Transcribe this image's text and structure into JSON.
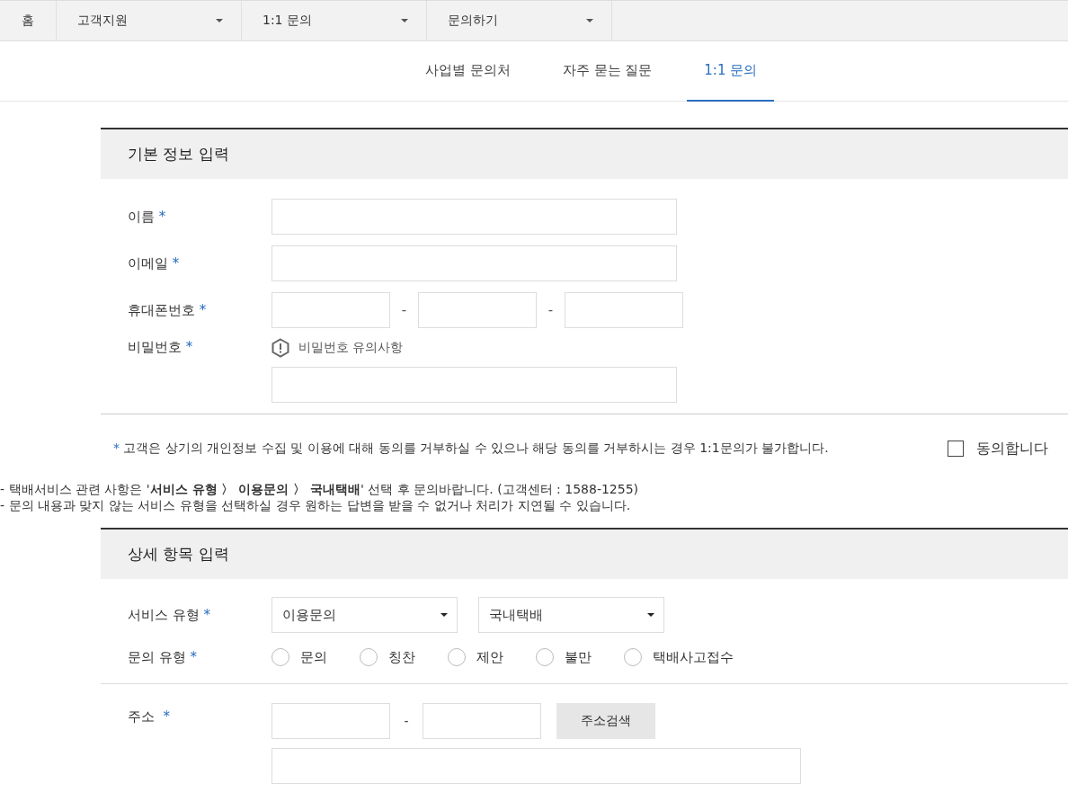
{
  "breadcrumb": [
    {
      "kind": "home",
      "label": "홈"
    },
    {
      "kind": "dropdown",
      "label": "고객지원"
    },
    {
      "kind": "dropdown",
      "label": "1:1 문의"
    },
    {
      "kind": "dropdown",
      "label": "문의하기"
    }
  ],
  "tabs": [
    {
      "label": "사업별 문의처",
      "selected": false
    },
    {
      "label": "자주 묻는 질문",
      "selected": false
    },
    {
      "label": "1:1 문의",
      "selected": true
    }
  ],
  "basic_section": {
    "title": "기본 정보 입력",
    "required_mark": "*",
    "name_label": "이름",
    "email_label": "이메일",
    "phone_label": "휴대폰번호",
    "phone_separator": "-",
    "password_label": "비밀번호",
    "password_notice": "비밀번호 유의사항"
  },
  "consent": {
    "mark": "*",
    "text": "고객은 상기의 개인정보 수집 및 이용에 대해 동의를 거부하실 수 있으나 해당 동의를 거부하시는 경우 1:1문의가 불가합니다.",
    "agree_label": "동의합니다",
    "checked": false
  },
  "notes": [
    "- 택배서비스 관련 사항은 '**서비스 유형 〉 이용문의 〉 국내택배**' 선택 후 문의바랍니다. (고객센터 : 1588-1255)",
    "- 문의 내용과 맞지 않는 서비스 유형을 선택하실 경우 원하는 답변을 받을 수 없거나 처리가 지연될 수 있습니다."
  ],
  "detail_section": {
    "title": "상세 항목 입력",
    "required_mark": "*",
    "service_type_label": "서비스 유형",
    "service_type": "이용문의",
    "service_subtype": "국내택배",
    "inquiry_type_label": "문의 유형",
    "inquiry_types": [
      {
        "label": "문의",
        "selected": false
      },
      {
        "label": "칭찬",
        "selected": false
      },
      {
        "label": "제안",
        "selected": false
      },
      {
        "label": "불만",
        "selected": false
      },
      {
        "label": "택배사고접수",
        "selected": false
      }
    ],
    "address_label": "주소",
    "address_separator": "-",
    "address_search_button": "주소검색"
  }
}
